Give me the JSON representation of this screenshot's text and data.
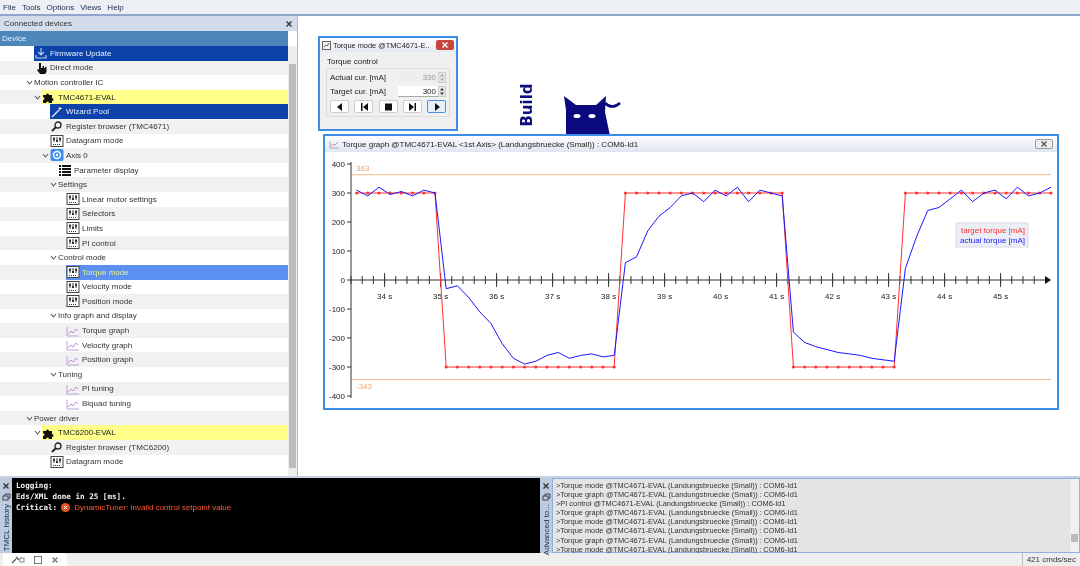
{
  "menu": [
    "File",
    "Tools",
    "Options",
    "Views",
    "Help"
  ],
  "device_panel": {
    "title": "Connected devices",
    "header": "Device",
    "tree": [
      {
        "label": "Firmware Update",
        "kind": "firmware",
        "highlighted": true,
        "selected": false
      },
      {
        "label": "Direct mode",
        "kind": "hand",
        "highlighted": false,
        "selected": false
      },
      {
        "label": "Motion controller IC",
        "kind": "category",
        "highlighted": false,
        "expanded": true,
        "selected": false,
        "children": [
          {
            "label": "TMC4671-EVAL",
            "kind": "device",
            "highlighted": false,
            "expanded": true,
            "selected": false,
            "children": [
              {
                "label": "Wizard Pool",
                "kind": "wand",
                "highlighted": true,
                "selected": false
              },
              {
                "label": "Register browser (TMC4671)",
                "kind": "register",
                "highlighted": false,
                "selected": false
              },
              {
                "label": "Datagram mode",
                "kind": "datagram",
                "highlighted": false,
                "selected": false
              },
              {
                "label": "Axis 0",
                "kind": "axis",
                "highlighted": false,
                "expanded": true,
                "selected": false,
                "children": [
                  {
                    "label": "Parameter display",
                    "kind": "params",
                    "highlighted": false,
                    "selected": false
                  },
                  {
                    "label": "Settings",
                    "kind": "category",
                    "highlighted": false,
                    "expanded": true,
                    "selected": false,
                    "children": [
                      {
                        "label": "Linear motor settings",
                        "kind": "datagram",
                        "highlighted": false,
                        "selected": false
                      },
                      {
                        "label": "Selectors",
                        "kind": "datagram",
                        "highlighted": false,
                        "selected": false
                      },
                      {
                        "label": "Limits",
                        "kind": "datagram",
                        "highlighted": false,
                        "selected": false
                      },
                      {
                        "label": "PI control",
                        "kind": "datagram",
                        "highlighted": false,
                        "selected": false
                      }
                    ]
                  },
                  {
                    "label": "Control mode",
                    "kind": "category",
                    "highlighted": false,
                    "expanded": true,
                    "selected": false,
                    "children": [
                      {
                        "label": "Torque mode",
                        "kind": "datagram",
                        "highlighted": false,
                        "selected": true
                      },
                      {
                        "label": "Velocity mode",
                        "kind": "datagram",
                        "highlighted": false,
                        "selected": false
                      },
                      {
                        "label": "Position mode",
                        "kind": "datagram",
                        "highlighted": false,
                        "selected": false
                      }
                    ]
                  },
                  {
                    "label": "Info graph and display",
                    "kind": "category",
                    "highlighted": false,
                    "expanded": true,
                    "selected": false,
                    "children": [
                      {
                        "label": "Torque graph",
                        "kind": "graph",
                        "highlighted": false,
                        "selected": false
                      },
                      {
                        "label": "Velocity graph",
                        "kind": "graph",
                        "highlighted": false,
                        "selected": false
                      },
                      {
                        "label": "Position graph",
                        "kind": "graph",
                        "highlighted": false,
                        "selected": false
                      }
                    ]
                  },
                  {
                    "label": "Tuning",
                    "kind": "category",
                    "highlighted": false,
                    "expanded": true,
                    "selected": false,
                    "children": [
                      {
                        "label": "PI tuning",
                        "kind": "graph",
                        "highlighted": false,
                        "selected": false
                      },
                      {
                        "label": "Biquad tuning",
                        "kind": "graph",
                        "highlighted": false,
                        "selected": false
                      }
                    ]
                  }
                ]
              }
            ]
          }
        ]
      },
      {
        "label": "Power driver",
        "kind": "category",
        "highlighted": false,
        "expanded": true,
        "selected": false,
        "children": [
          {
            "label": "TMC6200-EVAL",
            "kind": "device",
            "highlighted": false,
            "expanded": true,
            "selected": false,
            "children": [
              {
                "label": "Register browser (TMC6200)",
                "kind": "register",
                "highlighted": false,
                "selected": false
              },
              {
                "label": "Datagram mode",
                "kind": "datagram",
                "highlighted": false,
                "selected": false
              }
            ]
          }
        ]
      }
    ]
  },
  "background_logo": {
    "text": "Build"
  },
  "torque_window": {
    "title": "Torque mode @TMC4671-E..",
    "group": "Torque control",
    "fields": [
      {
        "label": "Actual cur. [mA]",
        "value": "330",
        "disabled": true
      },
      {
        "label": "Target cur. [mA]",
        "value": "300",
        "disabled": false
      }
    ],
    "buttons": [
      {
        "kind": "left",
        "selected": false
      },
      {
        "kind": "start",
        "selected": false
      },
      {
        "kind": "stop",
        "selected": false
      },
      {
        "kind": "end",
        "selected": false
      },
      {
        "kind": "right",
        "selected": true
      }
    ]
  },
  "graph_window": {
    "title": "Torque graph @TMC4671-EVAL <1st Axis> (Landungsbruecke (Small)) : COM6-Id1",
    "chart_data": {
      "type": "line",
      "xlim": [
        33.4,
        45.9
      ],
      "ylim": [
        -400,
        400
      ],
      "xticks": [
        {
          "value": 34,
          "label": "34 s"
        },
        {
          "value": 35,
          "label": "35 s"
        },
        {
          "value": 36,
          "label": "36 s"
        },
        {
          "value": 37,
          "label": "37 s"
        },
        {
          "value": 38,
          "label": "38 s"
        },
        {
          "value": 39,
          "label": "39 s"
        },
        {
          "value": 40,
          "label": "40 s"
        },
        {
          "value": 41,
          "label": "41 s"
        },
        {
          "value": 42,
          "label": "42 s"
        },
        {
          "value": 43,
          "label": "43 s"
        },
        {
          "value": 44,
          "label": "44 s"
        },
        {
          "value": 45,
          "label": "45 s"
        }
      ],
      "yticks": [
        -400,
        -300,
        -200,
        -100,
        0,
        100,
        200,
        300,
        400
      ],
      "ref_lines": [
        {
          "axis": "y",
          "value": 363,
          "label": "363"
        },
        {
          "axis": "y",
          "value": -343,
          "label": "-343"
        }
      ],
      "x": [
        33.5,
        33.7,
        33.9,
        34.1,
        34.3,
        34.5,
        34.7,
        34.9,
        35.1,
        35.3,
        35.5,
        35.7,
        35.9,
        36.1,
        36.3,
        36.5,
        36.7,
        36.9,
        37.1,
        37.3,
        37.5,
        37.7,
        37.9,
        38.1,
        38.3,
        38.5,
        38.7,
        38.9,
        39.1,
        39.3,
        39.5,
        39.7,
        39.9,
        40.1,
        40.3,
        40.5,
        40.7,
        40.9,
        41.1,
        41.3,
        41.5,
        41.7,
        41.9,
        42.1,
        42.3,
        42.5,
        42.7,
        42.9,
        43.1,
        43.3,
        43.5,
        43.7,
        43.9,
        44.1,
        44.3,
        44.5,
        44.7,
        44.9,
        45.1,
        45.3,
        45.5,
        45.7,
        45.9
      ],
      "series": [
        {
          "name": "target torque [mA]",
          "color": "#ff3030",
          "values": [
            300,
            300,
            300,
            300,
            300,
            300,
            300,
            300,
            -300,
            -300,
            -300,
            -300,
            -300,
            -300,
            -300,
            -300,
            -300,
            -300,
            -300,
            -300,
            -300,
            -300,
            -300,
            -300,
            300,
            300,
            300,
            300,
            300,
            300,
            300,
            300,
            300,
            300,
            300,
            300,
            300,
            300,
            300,
            -300,
            -300,
            -300,
            -300,
            -300,
            -300,
            -300,
            -300,
            -300,
            -300,
            300,
            300,
            300,
            300,
            300,
            300,
            300,
            300,
            300,
            300,
            300,
            300,
            300,
            300
          ]
        },
        {
          "name": "actual torque [mA]",
          "color": "#1818ff",
          "values": [
            310,
            290,
            320,
            295,
            305,
            290,
            310,
            300,
            -30,
            -20,
            -60,
            -110,
            -150,
            -220,
            -270,
            -290,
            -280,
            -260,
            -250,
            -270,
            -260,
            -255,
            -265,
            -260,
            60,
            80,
            170,
            220,
            250,
            290,
            300,
            270,
            310,
            290,
            320,
            270,
            310,
            300,
            290,
            -180,
            -215,
            -230,
            -240,
            -250,
            -255,
            -260,
            -270,
            -275,
            -280,
            40,
            150,
            240,
            250,
            280,
            310,
            270,
            300,
            310,
            280,
            320,
            290,
            300,
            320
          ]
        }
      ]
    }
  },
  "log_panel": {
    "tab": "TMCL history",
    "lines": [
      {
        "kind": "plain",
        "text": "Logging:"
      },
      {
        "kind": "plain",
        "text": "Eds/XML done in 25 [ms]."
      },
      {
        "kind": "critical",
        "prefix": "Critical:",
        "text": "DynamicTuner: Invalid control setpoint value"
      }
    ]
  },
  "history_panel": {
    "tab": "Advanced to...",
    "lines": [
      ">Torque mode @TMC4671-EVAL (Landungsbruecke (Small)) : COM6-Id1",
      ">Torque graph @TMC4671-EVAL (Landungsbruecke (Small)) : COM6-Id1",
      ">PI control @TMC4671-EVAL (Landungsbruecke (Small)) : COM6-Id1",
      ">Torque graph @TMC4671-EVAL (Landungsbruecke (Small)) : COM6-Id1",
      ">Torque mode @TMC4671-EVAL (Landungsbruecke (Small)) : COM6-Id1",
      ">Torque mode @TMC4671-EVAL (Landungsbruecke (Small)) : COM6-Id1",
      ">Torque graph @TMC4671-EVAL (Landungsbruecke (Small)) : COM6-Id1",
      ">Torque mode @TMC4671-EVAL (Landungsbruecke (Small)) : COM6-Id1"
    ]
  },
  "status_bar": {
    "rate": "421 cmds/sec"
  }
}
